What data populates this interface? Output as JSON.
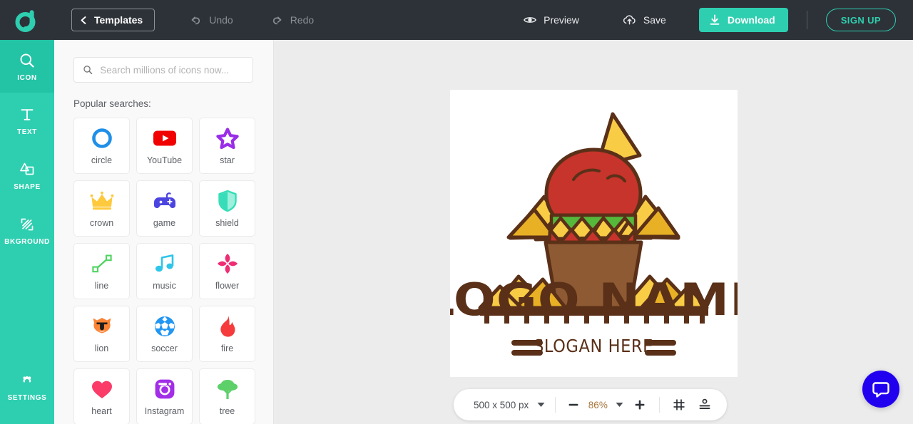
{
  "app": {
    "brand_icon": "designevo-droplet-logo",
    "accent_teal": "#2ecfb0",
    "topbar_bg": "#2d3238",
    "stage_bg": "#ececec",
    "panel_bg": "#f9f9f9"
  },
  "topbar": {
    "templates_label": "Templates",
    "back_icon": "chevron-left-icon",
    "undo_label": "Undo",
    "undo_icon": "undo-arrow-icon",
    "redo_label": "Redo",
    "redo_icon": "redo-arrow-icon",
    "preview_label": "Preview",
    "preview_icon": "eye-icon",
    "save_label": "Save",
    "save_icon": "cloud-upload-icon",
    "download_label": "Download",
    "download_icon": "download-icon",
    "signup_label": "SIGN UP"
  },
  "rail": {
    "items": [
      {
        "label": "ICON",
        "icon": "magnifier-icon",
        "active": true
      },
      {
        "label": "TEXT",
        "icon": "text-t-icon",
        "active": false
      },
      {
        "label": "SHAPE",
        "icon": "shapes-icon",
        "active": false
      },
      {
        "label": "BKGROUND",
        "icon": "hatched-square-icon",
        "active": false
      }
    ],
    "settings": {
      "label": "SETTINGS",
      "icon": "gear-icon"
    }
  },
  "panel": {
    "search_placeholder": "Search millions of icons now...",
    "search_value": "",
    "search_icon": "search-icon",
    "popular_label": "Popular searches:",
    "icons": [
      {
        "label": "circle",
        "icon": "circle-outline-icon",
        "color": "#1f8fe8"
      },
      {
        "label": "YouTube",
        "icon": "youtube-icon",
        "color": "#f00000"
      },
      {
        "label": "star",
        "icon": "star-outline-icon",
        "color": "#9a2ee8"
      },
      {
        "label": "crown",
        "icon": "crown-icon",
        "color": "#fec93c"
      },
      {
        "label": "game",
        "icon": "gamepad-icon",
        "color": "#4b44e0"
      },
      {
        "label": "shield",
        "icon": "shield-icon",
        "color": "#36ddb8"
      },
      {
        "label": "line",
        "icon": "line-segment-icon",
        "color": "#4ed45f"
      },
      {
        "label": "music",
        "icon": "music-note-icon",
        "color": "#2ec5e8"
      },
      {
        "label": "flower",
        "icon": "four-petal-flower-icon",
        "color": "#ef2d74"
      },
      {
        "label": "lion",
        "icon": "lion-face-icon",
        "color": "#fb8435"
      },
      {
        "label": "soccer",
        "icon": "soccer-ball-icon",
        "color": "#2196f3"
      },
      {
        "label": "fire",
        "icon": "flame-icon",
        "color": "#f53b3b"
      },
      {
        "label": "heart",
        "icon": "heart-icon",
        "color": "#fb3b68"
      },
      {
        "label": "Instagram",
        "icon": "instagram-icon",
        "color": "#a22ee8"
      },
      {
        "label": "tree",
        "icon": "tree-icon",
        "color": "#5ed06a"
      }
    ]
  },
  "canvas": {
    "logo": {
      "name_text": "LOGO NAME",
      "slogan_text": "SLOGAN HERE",
      "art_icon": "nachos-salsa-bowl-icon",
      "brown": "#5a3018",
      "red": "#c6342b",
      "green": "#56b83a",
      "yellow": "#f9cc46",
      "yellow_dark": "#e8b025",
      "bowl_brown": "#8e5a33"
    }
  },
  "zoombar": {
    "size_label": "500 x 500 px",
    "size_caret": "chevron-down-icon",
    "minus_icon": "minus-icon",
    "zoom_value": "86%",
    "zoom_caret": "chevron-down-icon",
    "plus_icon": "plus-icon",
    "grid_icon": "grid-icon",
    "guides_icon": "alignment-guides-icon"
  },
  "chat": {
    "icon": "chat-bubble-icon",
    "color": "#2100ef"
  }
}
